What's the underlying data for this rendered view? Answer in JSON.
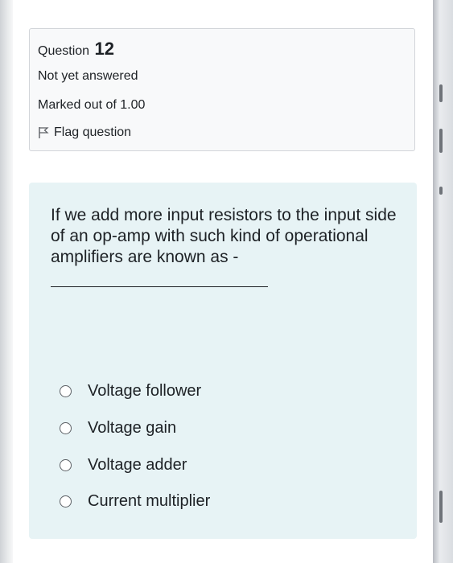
{
  "question_info": {
    "question_label": "Question",
    "question_number": "12",
    "status": "Not yet answered",
    "marks": "Marked out of 1.00",
    "flag_label": "Flag question"
  },
  "question": {
    "text": "If we add more input resistors to the input side of an op-amp with such kind of operational amplifiers are known as -",
    "options": [
      {
        "label": "Voltage follower"
      },
      {
        "label": "Voltage gain"
      },
      {
        "label": "Voltage adder"
      },
      {
        "label": "Current multiplier"
      }
    ]
  },
  "colors": {
    "info_background": "#f8f9fa",
    "content_background": "#e7f3f5",
    "text": "#1d2125"
  }
}
